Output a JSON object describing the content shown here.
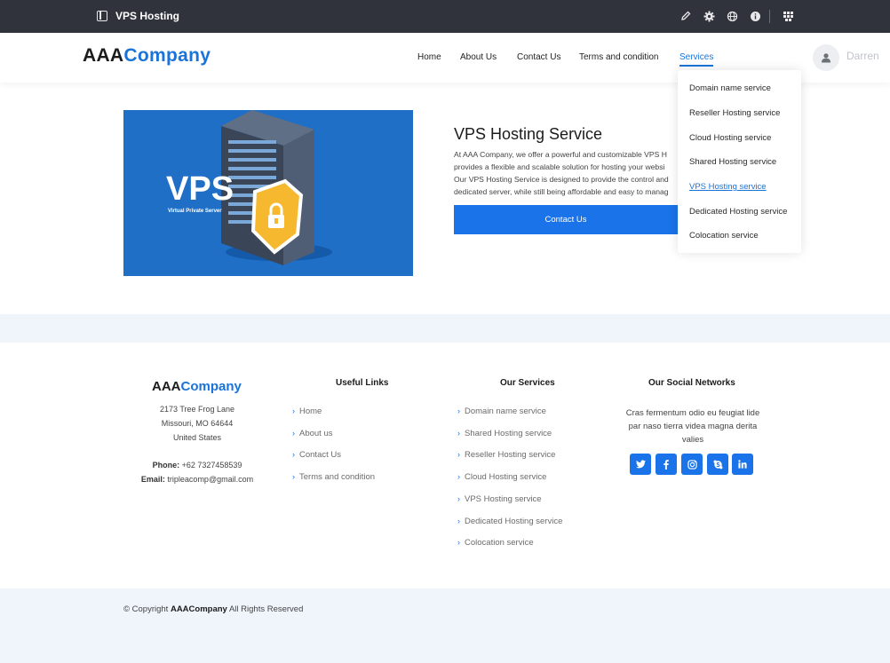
{
  "appbar": {
    "title": "VPS Hosting",
    "icons": [
      "panel-icon",
      "pencil-icon",
      "gear-icon",
      "globe-icon",
      "info-icon",
      "apps-grid-icon"
    ]
  },
  "header": {
    "logo_part1": "AAA",
    "logo_part2": "Company",
    "nav": [
      "Home",
      "About Us",
      "Contact Us",
      "Terms and condition",
      "Services"
    ],
    "active_nav": "Services",
    "user_name": "Darren"
  },
  "dropdown": {
    "items": [
      "Domain name service",
      "Reseller Hosting service",
      "Cloud Hosting service",
      "Shared Hosting service",
      "VPS Hosting service",
      "Dedicated Hosting service",
      "Colocation service"
    ],
    "active": "VPS Hosting service"
  },
  "hero": {
    "image_text": "VPS",
    "image_subtext": "Virtual Private Server",
    "title": "VPS Hosting Service",
    "desc_lines": [
      "At AAA Company, we offer a powerful and customizable VPS H",
      "provides a flexible and scalable solution for hosting your websi",
      "Our VPS Hosting Service is designed to provide the control and",
      "dedicated server, while still being affordable and easy to manag"
    ],
    "button": "Contact Us"
  },
  "footer": {
    "logo_part1": "AAA",
    "logo_part2": "Company",
    "address_lines": [
      "2173 Tree Frog Lane",
      "Missouri, MO 64644",
      "United States"
    ],
    "phone_label": "Phone:",
    "phone": "+62 7327458539",
    "email_label": "Email:",
    "email": "tripleacomp@gmail.com",
    "useful_links_title": "Useful Links",
    "useful_links": [
      "Home",
      "About us",
      "Contact Us",
      "Terms and condition"
    ],
    "services_title": "Our Services",
    "services": [
      "Domain name service",
      "Shared Hosting service",
      "Reseller Hosting service",
      "Cloud Hosting service",
      "VPS Hosting service",
      "Dedicated Hosting service",
      "Colocation service"
    ],
    "social_title": "Our Social Networks",
    "social_text": "Cras fermentum odio eu feugiat lide par naso tierra videa magna derita valies",
    "social_icons": [
      "twitter-icon",
      "facebook-icon",
      "instagram-icon",
      "skype-icon",
      "linkedin-icon"
    ],
    "copyright_prefix": "© Copyright",
    "copyright_brand": "AAACompany",
    "copyright_suffix": "All Rights Reserved"
  },
  "colors": {
    "accent": "#1a73e8",
    "appbar": "#30323c",
    "band": "#f0f4fb"
  }
}
